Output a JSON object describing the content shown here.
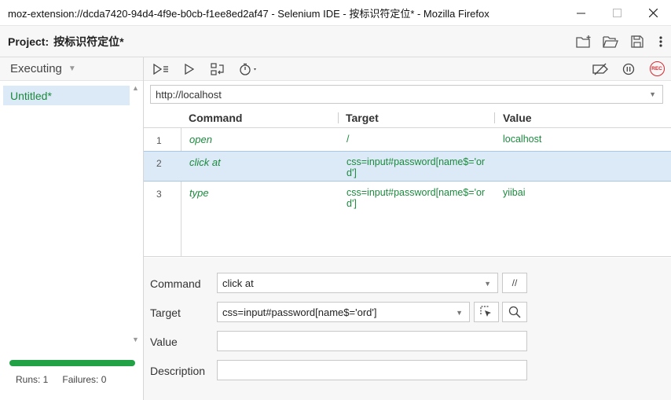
{
  "window": {
    "title": "moz-extension://dcda7420-94d4-4f9e-b0cb-f1ee8ed2af47 - Selenium IDE - 按标识符定位* - Mozilla Firefox"
  },
  "project": {
    "label": "Project:",
    "name": "按标识符定位*"
  },
  "sidebar": {
    "mode": "Executing",
    "tests": [
      {
        "name": "Untitled*"
      }
    ],
    "runs": "Runs: 1",
    "failures": "Failures: 0",
    "progress_percent": 100
  },
  "base_url": "http://localhost",
  "table": {
    "headers": [
      "Command",
      "Target",
      "Value"
    ],
    "rows": [
      {
        "num": "1",
        "command": "open",
        "target": "/",
        "value": "localhost"
      },
      {
        "num": "2",
        "command": "click at",
        "target": "css=input#password[name$='ord']",
        "value": ""
      },
      {
        "num": "3",
        "command": "type",
        "target": "css=input#password[name$='ord']",
        "value": "yiibai"
      }
    ]
  },
  "editor": {
    "command_label": "Command",
    "command_value": "click at",
    "comment_button": "//",
    "target_label": "Target",
    "target_value": "css=input#password[name$='ord']",
    "value_label": "Value",
    "value_value": "",
    "description_label": "Description",
    "description_value": ""
  },
  "rec_label": "REC",
  "colors": {
    "accent_green": "#1c8a3e",
    "selection": "#dbeaf6",
    "progress": "#22a146",
    "record": "#d8272d"
  }
}
